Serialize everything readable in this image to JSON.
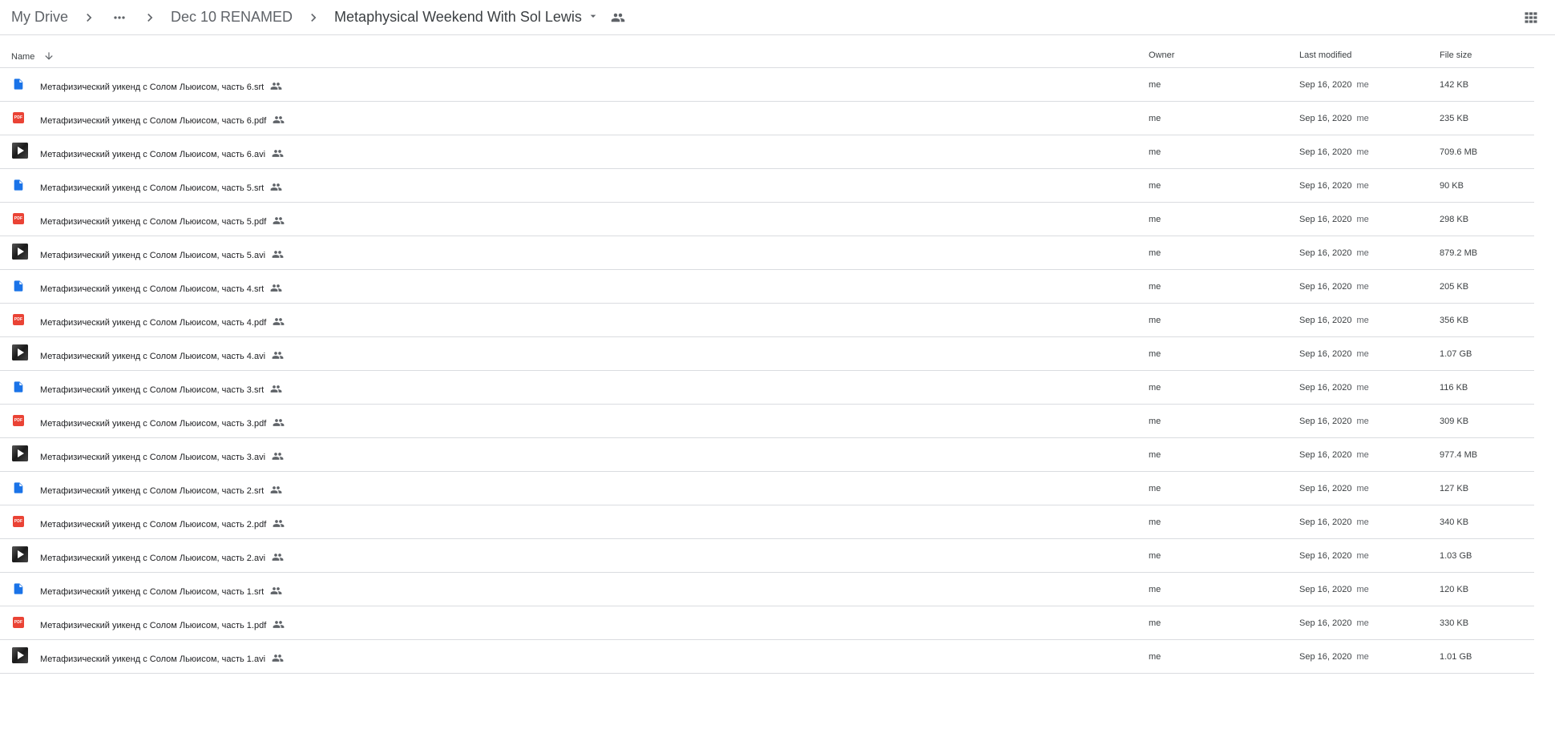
{
  "breadcrumb": {
    "root": "My Drive",
    "parent": "Dec 10 RENAMED",
    "current": "Metaphysical Weekend With Sol Lewis"
  },
  "icons": {
    "chevron": "chevron-right-icon",
    "more": "more-horiz-icon",
    "dropdown": "arrow-drop-down-icon",
    "shared": "people-icon",
    "grid": "grid-view-icon",
    "sort": "arrow-downward-icon",
    "doc": "google-doc-icon",
    "pdf": "pdf-icon",
    "video": "video-thumbnail-icon"
  },
  "colors": {
    "doc_blue": "#1a73e8",
    "pdf_red": "#ea4335",
    "icon_grey": "#5f6368",
    "divider": "#dadce0"
  },
  "columns": {
    "name": "Name",
    "owner": "Owner",
    "modified": "Last modified",
    "size": "File size"
  },
  "pdf_badge": "PDF",
  "files": [
    {
      "type": "doc",
      "name": "Метафизический уикенд с Солом Льюисом, часть 6.srt",
      "owner": "me",
      "modified": "Sep 16, 2020",
      "modified_by": "me",
      "size": "142 KB"
    },
    {
      "type": "pdf",
      "name": "Метафизический уикенд с Солом Льюисом, часть 6.pdf",
      "owner": "me",
      "modified": "Sep 16, 2020",
      "modified_by": "me",
      "size": "235 KB"
    },
    {
      "type": "video",
      "name": "Метафизический уикенд с Солом Льюисом, часть 6.avi",
      "owner": "me",
      "modified": "Sep 16, 2020",
      "modified_by": "me",
      "size": "709.6 MB"
    },
    {
      "type": "doc",
      "name": "Метафизический уикенд с Солом Льюисом, часть 5.srt",
      "owner": "me",
      "modified": "Sep 16, 2020",
      "modified_by": "me",
      "size": "90 KB"
    },
    {
      "type": "pdf",
      "name": "Метафизический уикенд с Солом Льюисом, часть 5.pdf",
      "owner": "me",
      "modified": "Sep 16, 2020",
      "modified_by": "me",
      "size": "298 KB"
    },
    {
      "type": "video",
      "name": "Метафизический уикенд с Солом Льюисом, часть 5.avi",
      "owner": "me",
      "modified": "Sep 16, 2020",
      "modified_by": "me",
      "size": "879.2 MB"
    },
    {
      "type": "doc",
      "name": "Метафизический уикенд с Солом Льюисом, часть 4.srt",
      "owner": "me",
      "modified": "Sep 16, 2020",
      "modified_by": "me",
      "size": "205 KB"
    },
    {
      "type": "pdf",
      "name": "Метафизический уикенд с Солом Льюисом, часть 4.pdf",
      "owner": "me",
      "modified": "Sep 16, 2020",
      "modified_by": "me",
      "size": "356 KB"
    },
    {
      "type": "video",
      "name": "Метафизический уикенд с Солом Льюисом, часть 4.avi",
      "owner": "me",
      "modified": "Sep 16, 2020",
      "modified_by": "me",
      "size": "1.07 GB"
    },
    {
      "type": "doc",
      "name": "Метафизический уикенд с Солом Льюисом, часть 3.srt",
      "owner": "me",
      "modified": "Sep 16, 2020",
      "modified_by": "me",
      "size": "116 KB"
    },
    {
      "type": "pdf",
      "name": "Метафизический уикенд с Солом Льюисом, часть 3.pdf",
      "owner": "me",
      "modified": "Sep 16, 2020",
      "modified_by": "me",
      "size": "309 KB"
    },
    {
      "type": "video",
      "name": "Метафизический уикенд с Солом Льюисом, часть 3.avi",
      "owner": "me",
      "modified": "Sep 16, 2020",
      "modified_by": "me",
      "size": "977.4 MB"
    },
    {
      "type": "doc",
      "name": "Метафизический уикенд с Солом Льюисом, часть 2.srt",
      "owner": "me",
      "modified": "Sep 16, 2020",
      "modified_by": "me",
      "size": "127 KB"
    },
    {
      "type": "pdf",
      "name": "Метафизический уикенд с Солом Льюисом, часть 2.pdf",
      "owner": "me",
      "modified": "Sep 16, 2020",
      "modified_by": "me",
      "size": "340 KB"
    },
    {
      "type": "video",
      "name": "Метафизический уикенд с Солом Льюисом, часть 2.avi",
      "owner": "me",
      "modified": "Sep 16, 2020",
      "modified_by": "me",
      "size": "1.03 GB"
    },
    {
      "type": "doc",
      "name": "Метафизический уикенд с Солом Льюисом, часть 1.srt",
      "owner": "me",
      "modified": "Sep 16, 2020",
      "modified_by": "me",
      "size": "120 KB"
    },
    {
      "type": "pdf",
      "name": "Метафизический уикенд с Солом Льюисом, часть 1.pdf",
      "owner": "me",
      "modified": "Sep 16, 2020",
      "modified_by": "me",
      "size": "330 KB"
    },
    {
      "type": "video",
      "name": "Метафизический уикенд с Солом Льюисом, часть 1.avi",
      "owner": "me",
      "modified": "Sep 16, 2020",
      "modified_by": "me",
      "size": "1.01 GB"
    }
  ]
}
